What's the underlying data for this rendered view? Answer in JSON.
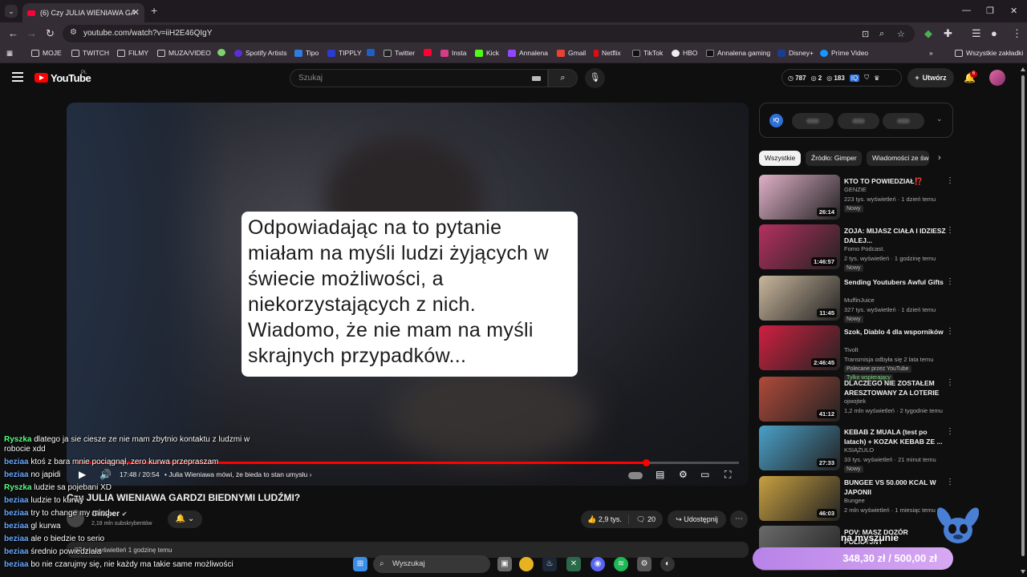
{
  "browser": {
    "tab_title": "(6) Czy JULIA WIENIAWA GARDZI BIEDNYMI LUDŹMI? - YouTube",
    "url": "youtube.com/watch?v=iiH2E46QIgY",
    "bookmarks": [
      "MOJE",
      "TWITCH",
      "FILMY",
      "MUZA/VIDEO",
      "Spotify Artists",
      "Tipo",
      "TIPPLY",
      "Twitter",
      "Insta",
      "Kick",
      "Annalena",
      "Gmail",
      "Netflix",
      "TikTok",
      "HBO",
      "Annalena gaming",
      "Disney+",
      "Prime Video"
    ],
    "all_bookmarks": "Wszystkie zakładki"
  },
  "youtube": {
    "logo": "YouTube",
    "region": "PL",
    "search_placeholder": "Szukaj",
    "stats": {
      "views": "787",
      "a": "2",
      "b": "183"
    },
    "create_label": "Utwórz",
    "notif_count": "6"
  },
  "video": {
    "quote": "Odpowiadając na to pytanie miałam na myśli ludzi żyjących w świecie możliwości, a niekorzystających z nich. Wiadomo, że nie mam na myśli skrajnych przypadków...",
    "progress": 0.86,
    "time": "17:48 / 20:54",
    "chapter": "Julia Wieniawa mówi, że bieda to stan umysłu",
    "title": "Czy JULIA WIENIAWA GARDZI BIEDNYMI LUDŹMI?",
    "channel": "Gimper",
    "subscribers": "2,18 mln subskrybentów",
    "likes": "2,9 tys.",
    "comments": "20",
    "share": "Udostępnij",
    "description_meta": "47 tys. wyświetleń  1 godzinę temu"
  },
  "sidebar": {
    "chips": [
      "Wszystkie",
      "Źródło: Gimper",
      "Wiadomości ze świata"
    ],
    "recommendations": [
      {
        "title": "KTO TO POWIEDZIAŁ⁉️",
        "channel": "GENZIE",
        "meta": "223 tys. wyświetleń · 1 dzień temu",
        "badge": "Nowy",
        "duration": "26:14",
        "color": "#e0b0c8"
      },
      {
        "title": "ZOJA: MIJASZ CIAŁA I IDZIESZ DALEJ...",
        "channel": "Fomo Podcast.",
        "meta": "2 tys. wyświetleń · 1 godzinę temu",
        "badge": "Nowy",
        "duration": "1:46:57",
        "color": "#b5305f"
      },
      {
        "title": "Sending Youtubers Awful Gifts",
        "channel": "MuffinJuice",
        "meta": "327 tys. wyświetleń · 1 dzień temu",
        "badge": "Nowy",
        "duration": "11:45",
        "color": "#c9b79d"
      },
      {
        "title": "Szok, Diablo 4 dla wsporników",
        "channel": "Tivolt",
        "meta": "Transmisja odbyła się 2 lata temu",
        "badge": "Polecane przez YouTube",
        "badge2": "Tylko wspierający",
        "duration": "2:46:45",
        "color": "#d02040"
      },
      {
        "title": "DLACZEGO NIE ZOSTAŁEM ARESZTOWANY ZA LOTERIE",
        "channel": "ojwojtek",
        "meta": "1,2 mln wyświetleń · 2 tygodnie temu",
        "duration": "41:12",
        "color": "#b04a3a"
      },
      {
        "title": "KEBAB Z MUALA (test po latach) + KOZAK KEBAB ZE ...",
        "channel": "KSIĄŻULO",
        "meta": "33 tys. wyświetleń · 21 minut temu",
        "badge": "Nowy",
        "duration": "27:33",
        "color": "#4aa0c8"
      },
      {
        "title": "BUNGEE VS 50.000 KCAL W JAPONII",
        "channel": "Bungee",
        "meta": "2 mln wyświetleń · 1 miesiąc temu",
        "duration": "46:03",
        "color": "#c8a040"
      },
      {
        "title": "POV: MASZ DOZÓR POLICYJNY",
        "channel": "",
        "meta": "",
        "duration": "",
        "color": "#6a6a6a"
      }
    ]
  },
  "chat": [
    {
      "user": "Ryszka",
      "text": "dlatego ja sie ciesze ze nie mam zbytnio kontaktu z ludzmi w",
      "cont": "robocie xdd",
      "kind": "u1"
    },
    {
      "user": "beziaa",
      "text": "ktoś z bara mnie pociągnął, zero kurwa przepraszam",
      "kind": "u2"
    },
    {
      "user": "beziaa",
      "text": "no japidi",
      "kind": "u2"
    },
    {
      "user": "Ryszka",
      "text": "ludzie sa pojebani XD",
      "kind": "u1"
    },
    {
      "user": "beziaa",
      "text": "ludzie to kurwy",
      "kind": "u2"
    },
    {
      "user": "beziaa",
      "text": "try to change my mind",
      "kind": "u2"
    },
    {
      "user": "beziaa",
      "text": "gl kurwa",
      "kind": "u2"
    },
    {
      "user": "beziaa",
      "text": "ale o biedzie to serio",
      "kind": "u2"
    },
    {
      "user": "beziaa",
      "text": "średnio powiedziała",
      "kind": "u2"
    },
    {
      "user": "beziaa",
      "text": "bo nie czarujmy się, nie każdy ma takie same możliwości",
      "kind": "u2"
    }
  ],
  "overlay": {
    "stream_text": "na myszunie",
    "donation": "348,30 zł / 500,00 zł"
  },
  "taskbar": {
    "search": "Wyszukaj"
  }
}
